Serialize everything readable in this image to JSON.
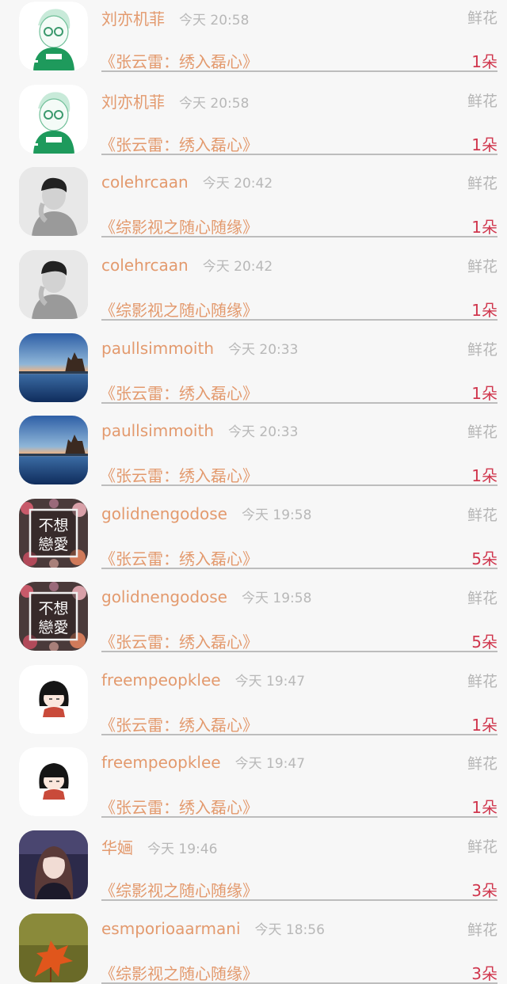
{
  "records": [
    {
      "avatar": "avatar-cartoon-boy-green",
      "user": "刘亦机菲",
      "time": "今天 20:58",
      "gift": "鲜花",
      "book": "《张云雷：绣入磊心》",
      "count": "1朵"
    },
    {
      "avatar": "avatar-cartoon-boy-green",
      "user": "刘亦机菲",
      "time": "今天 20:58",
      "gift": "鲜花",
      "book": "《张云雷：绣入磊心》",
      "count": "1朵"
    },
    {
      "avatar": "avatar-bw-portrait",
      "user": "colehrcaan",
      "time": "今天 20:42",
      "gift": "鲜花",
      "book": "《综影视之随心随缘》",
      "count": "1朵"
    },
    {
      "avatar": "avatar-bw-portrait",
      "user": "colehrcaan",
      "time": "今天 20:42",
      "gift": "鲜花",
      "book": "《综影视之随心随缘》",
      "count": "1朵"
    },
    {
      "avatar": "avatar-lake-sunset",
      "user": "paullsimmoith",
      "time": "今天 20:33",
      "gift": "鲜花",
      "book": "《张云雷：绣入磊心》",
      "count": "1朵"
    },
    {
      "avatar": "avatar-lake-sunset",
      "user": "paullsimmoith",
      "time": "今天 20:33",
      "gift": "鲜花",
      "book": "《张云雷：绣入磊心》",
      "count": "1朵"
    },
    {
      "avatar": "avatar-text-flowers",
      "avatar_text": [
        "不想",
        "戀愛"
      ],
      "user": "golidnengodose",
      "time": "今天 19:58",
      "gift": "鲜花",
      "book": "《张云雷：绣入磊心》",
      "count": "5朵"
    },
    {
      "avatar": "avatar-text-flowers",
      "avatar_text": [
        "不想",
        "戀愛"
      ],
      "user": "golidnengodose",
      "time": "今天 19:58",
      "gift": "鲜花",
      "book": "《张云雷：绣入磊心》",
      "count": "5朵"
    },
    {
      "avatar": "avatar-cartoon-girl",
      "user": "freempeopklee",
      "time": "今天 19:47",
      "gift": "鲜花",
      "book": "《张云雷：绣入磊心》",
      "count": "1朵"
    },
    {
      "avatar": "avatar-cartoon-girl",
      "user": "freempeopklee",
      "time": "今天 19:47",
      "gift": "鲜花",
      "book": "《张云雷：绣入磊心》",
      "count": "1朵"
    },
    {
      "avatar": "avatar-girl-portrait",
      "user": "华婳",
      "time": "今天 19:46",
      "gift": "鲜花",
      "book": "《综影视之随心随缘》",
      "count": "3朵"
    },
    {
      "avatar": "avatar-autumn-leaf",
      "user": "esmporioaarmani",
      "time": "今天 18:56",
      "gift": "鲜花",
      "book": "《综影视之随心随缘》",
      "count": "3朵"
    }
  ]
}
